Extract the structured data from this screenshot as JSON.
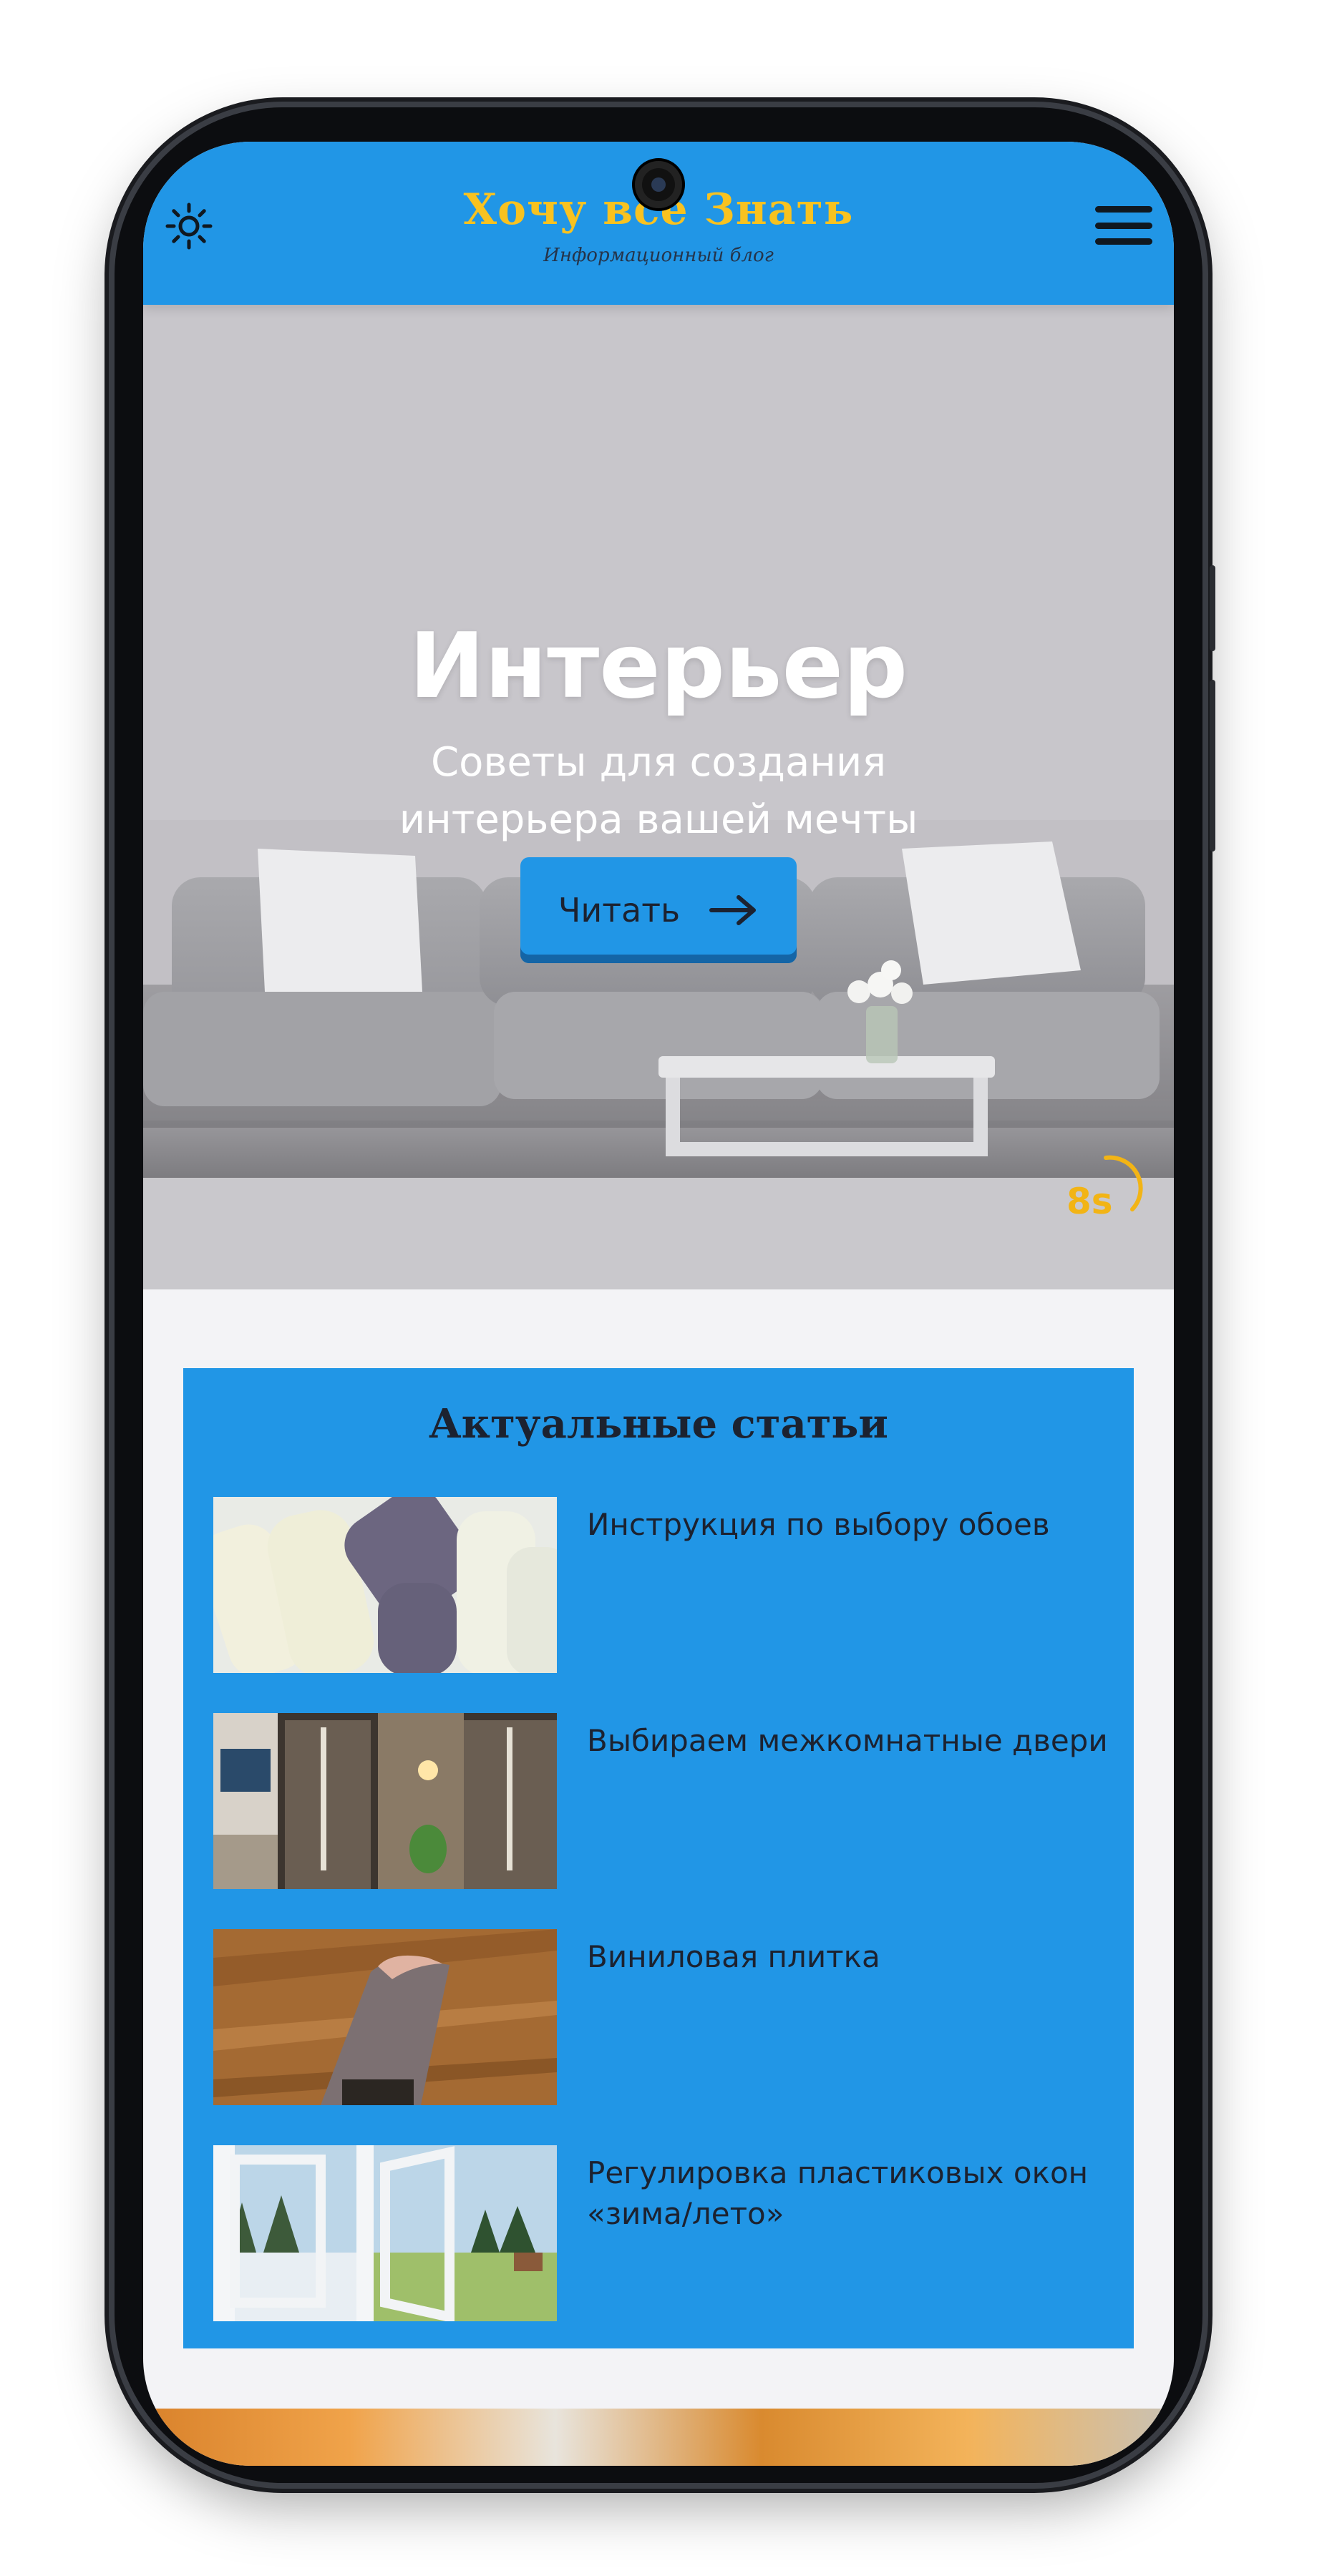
{
  "header": {
    "title": "Хочу все Знать",
    "tagline": "Информационный блог"
  },
  "hero": {
    "title": "Интерьер",
    "subtitle": "Советы для создания интерьера вашей мечты",
    "button_label": "Читать",
    "timer": "8s"
  },
  "articles": {
    "title": "Актуальные статьи",
    "items": [
      {
        "title": "Инструкция по выбору обоев"
      },
      {
        "title": "Выбираем межкомнатные двери"
      },
      {
        "title": "Виниловая плитка"
      },
      {
        "title": "Регулировка пластиковых окон «зима/лето»"
      }
    ]
  },
  "colors": {
    "accent": "#2196e6",
    "brand_yellow": "#f8c220",
    "text_dark": "#1c2230"
  },
  "icons": [
    "sun-icon",
    "hamburger-menu-icon",
    "arrow-right-icon",
    "timer-ring-icon"
  ]
}
